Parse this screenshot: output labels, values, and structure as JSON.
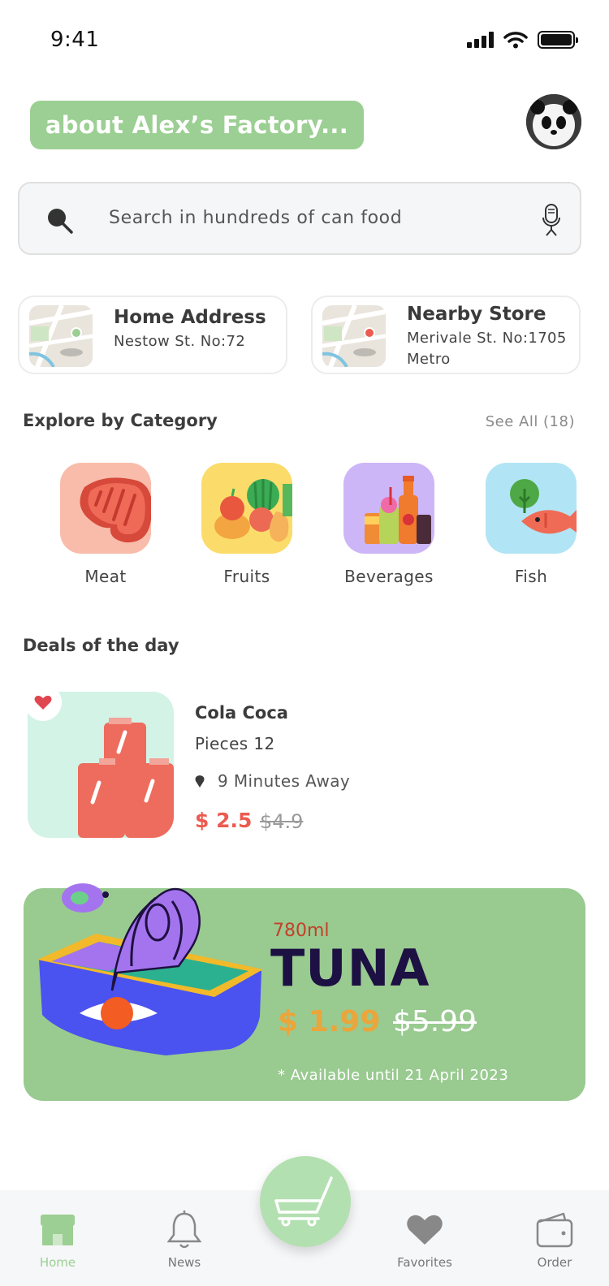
{
  "status_bar": {
    "time": "9:41"
  },
  "header": {
    "factory_label": "about Alex’s Factory..."
  },
  "search": {
    "placeholder": "Search in hundreds of can food"
  },
  "addresses": [
    {
      "title": "Home Address",
      "line1": "Nestow St. No:72",
      "line2": ""
    },
    {
      "title": "Nearby Store",
      "line1": "Merivale St. No:1705",
      "line2": "Metro"
    }
  ],
  "categories_section": {
    "title": "Explore by Category",
    "see_all": "See All (18)"
  },
  "categories": [
    {
      "label": "Meat",
      "color": "#f9bcaa"
    },
    {
      "label": "Fruits",
      "color": "#fbdc6a"
    },
    {
      "label": "Beverages",
      "color": "#cdb6f7"
    },
    {
      "label": "Fish",
      "color": "#b1e5f5"
    }
  ],
  "deals_section": {
    "title": "Deals of the day"
  },
  "deal": {
    "name": "Cola Coca",
    "pieces": "Pieces 12",
    "distance": "9 Minutes Away",
    "price": "$ 2.5",
    "old_price": "$4.9"
  },
  "promo": {
    "size": "780ml",
    "name": "TUNA",
    "price": "$ 1.99",
    "old_price": "$5.99",
    "note": "* Available until 21 April 2023"
  },
  "nav": {
    "home": "Home",
    "news": "News",
    "favorites": "Favorites",
    "order": "Order"
  },
  "colors": {
    "accent": "#9ccf93",
    "price_red": "#ec5b4f",
    "promo_bg": "#99ca90"
  }
}
